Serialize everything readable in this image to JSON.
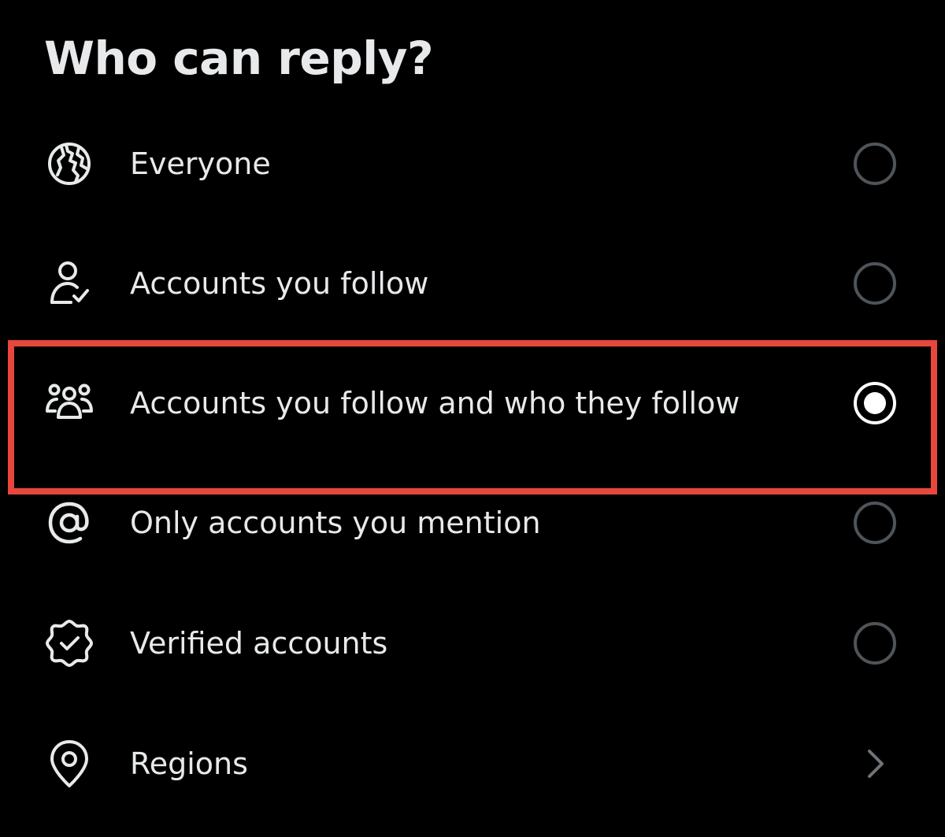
{
  "dialog": {
    "title": "Who can reply?"
  },
  "colors": {
    "background": "#000000",
    "text": "#e7e9ea",
    "radio_unselected": "#4f5459",
    "radio_selected": "#ffffff",
    "highlight": "#e8473d"
  },
  "options": [
    {
      "label": "Everyone",
      "icon": "globe-icon",
      "control": "radio",
      "selected": false
    },
    {
      "label": "Accounts you follow",
      "icon": "person-check-icon",
      "control": "radio",
      "selected": false
    },
    {
      "label": "Accounts you follow and who they follow",
      "icon": "people-group-icon",
      "control": "radio",
      "selected": true
    },
    {
      "label": "Only accounts you mention",
      "icon": "at-sign-icon",
      "control": "radio",
      "selected": false
    },
    {
      "label": "Verified accounts",
      "icon": "verified-badge-icon",
      "control": "radio",
      "selected": false
    },
    {
      "label": "Regions",
      "icon": "location-pin-icon",
      "control": "chevron",
      "selected": false
    }
  ]
}
